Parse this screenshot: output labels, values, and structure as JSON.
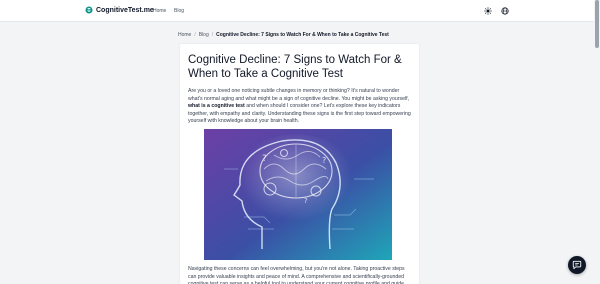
{
  "brand": {
    "name": "CognitiveTest.me",
    "icon": "brain-icon"
  },
  "nav": {
    "home": "Home",
    "blog": "Blog"
  },
  "header_icons": {
    "theme": "sun-icon",
    "language": "globe-icon"
  },
  "breadcrumb": {
    "home": "Home",
    "blog": "Blog",
    "current": "Cognitive Decline: 7 Signs to Watch For & When to Take a Cognitive Test"
  },
  "article": {
    "title": "Cognitive Decline: 7 Signs to Watch For & When to Take a Cognitive Test",
    "intro_part1": "Are you or a loved one noticing subtle changes in memory or thinking? It's natural to wonder what's normal aging and what might be a sign of cognitive decline. You might be asking yourself, ",
    "intro_bold": "what is a cognitive test",
    "intro_part2": " and when should I consider one? Let's explore these key indicators together, with empathy and clarity. Understanding these signs is the first step toward empowering yourself with knowledge about your brain health.",
    "paragraph2": "Navigating these concerns can feel overwhelming, but you're not alone. Taking proactive steps can provide valuable insights and peace of mind. A comprehensive and scientifically-grounded cognitive test can serve as a helpful tool to understand your current cognitive profile and guide your next steps."
  },
  "chat": {
    "icon": "chat-icon"
  },
  "colors": {
    "accent": "#0d9488",
    "dark": "#111827",
    "card": "#ffffff",
    "page_bg": "#f3f4f6"
  }
}
